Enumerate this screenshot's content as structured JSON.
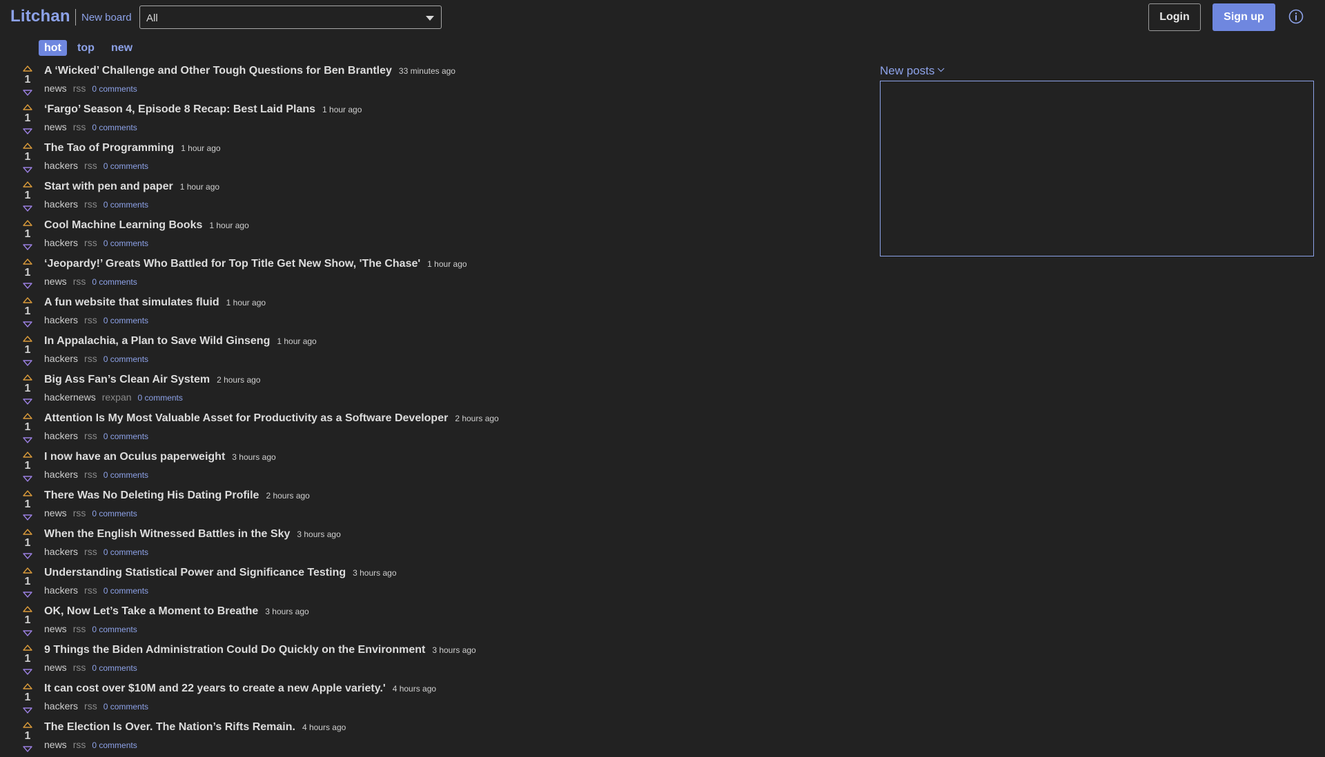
{
  "header": {
    "brand": "Litchan",
    "new_board_label": "New board",
    "board_select_value": "All",
    "login_label": "Login",
    "signup_label": "Sign up",
    "info_icon": "info-icon"
  },
  "sort_tabs": [
    {
      "label": "hot",
      "active": true
    },
    {
      "label": "top",
      "active": false
    },
    {
      "label": "new",
      "active": false
    }
  ],
  "sidebar": {
    "new_posts_label": "New posts"
  },
  "colors": {
    "background": "#222222",
    "accent": "#8da2e8",
    "button_primary": "#6f87df",
    "upvote": "#d99a3a",
    "downvote": "#9a7fe0"
  },
  "posts": [
    {
      "score": "1",
      "title": "A ‘Wicked’ Challenge and Other Tough Questions for Ben Brantley",
      "time": "33 minutes ago",
      "board": "news",
      "source": "rss",
      "comments": "0 comments"
    },
    {
      "score": "1",
      "title": "‘Fargo’ Season 4, Episode 8 Recap: Best Laid Plans",
      "time": "1 hour ago",
      "board": "news",
      "source": "rss",
      "comments": "0 comments"
    },
    {
      "score": "1",
      "title": "The Tao of Programming",
      "time": "1 hour ago",
      "board": "hackers",
      "source": "rss",
      "comments": "0 comments"
    },
    {
      "score": "1",
      "title": "Start with pen and paper",
      "time": "1 hour ago",
      "board": "hackers",
      "source": "rss",
      "comments": "0 comments"
    },
    {
      "score": "1",
      "title": "Cool Machine Learning Books",
      "time": "1 hour ago",
      "board": "hackers",
      "source": "rss",
      "comments": "0 comments"
    },
    {
      "score": "1",
      "title": "‘Jeopardy!’ Greats Who Battled for Top Title Get New Show, 'The Chase'",
      "time": "1 hour ago",
      "board": "news",
      "source": "rss",
      "comments": "0 comments"
    },
    {
      "score": "1",
      "title": "A fun website that simulates fluid",
      "time": "1 hour ago",
      "board": "hackers",
      "source": "rss",
      "comments": "0 comments"
    },
    {
      "score": "1",
      "title": "In Appalachia, a Plan to Save Wild Ginseng",
      "time": "1 hour ago",
      "board": "hackers",
      "source": "rss",
      "comments": "0 comments"
    },
    {
      "score": "1",
      "title": "Big Ass Fan’s Clean Air System",
      "time": "2 hours ago",
      "board": "hackernews",
      "source": "rexpan",
      "comments": "0 comments"
    },
    {
      "score": "1",
      "title": "Attention Is My Most Valuable Asset for Productivity as a Software Developer",
      "time": "2 hours ago",
      "board": "hackers",
      "source": "rss",
      "comments": "0 comments"
    },
    {
      "score": "1",
      "title": "I now have an Oculus paperweight",
      "time": "3 hours ago",
      "board": "hackers",
      "source": "rss",
      "comments": "0 comments"
    },
    {
      "score": "1",
      "title": "There Was No Deleting His Dating Profile",
      "time": "2 hours ago",
      "board": "news",
      "source": "rss",
      "comments": "0 comments"
    },
    {
      "score": "1",
      "title": "When the English Witnessed Battles in the Sky",
      "time": "3 hours ago",
      "board": "hackers",
      "source": "rss",
      "comments": "0 comments"
    },
    {
      "score": "1",
      "title": "Understanding Statistical Power and Significance Testing",
      "time": "3 hours ago",
      "board": "hackers",
      "source": "rss",
      "comments": "0 comments"
    },
    {
      "score": "1",
      "title": "OK, Now Let’s Take a Moment to Breathe",
      "time": "3 hours ago",
      "board": "news",
      "source": "rss",
      "comments": "0 comments"
    },
    {
      "score": "1",
      "title": "9 Things the Biden Administration Could Do Quickly on the Environment",
      "time": "3 hours ago",
      "board": "news",
      "source": "rss",
      "comments": "0 comments"
    },
    {
      "score": "1",
      "title": "It can cost over $10M and 22 years to create a new Apple variety.'",
      "time": "4 hours ago",
      "board": "hackers",
      "source": "rss",
      "comments": "0 comments"
    },
    {
      "score": "1",
      "title": "The Election Is Over. The Nation’s Rifts Remain.",
      "time": "4 hours ago",
      "board": "news",
      "source": "rss",
      "comments": "0 comments"
    }
  ]
}
